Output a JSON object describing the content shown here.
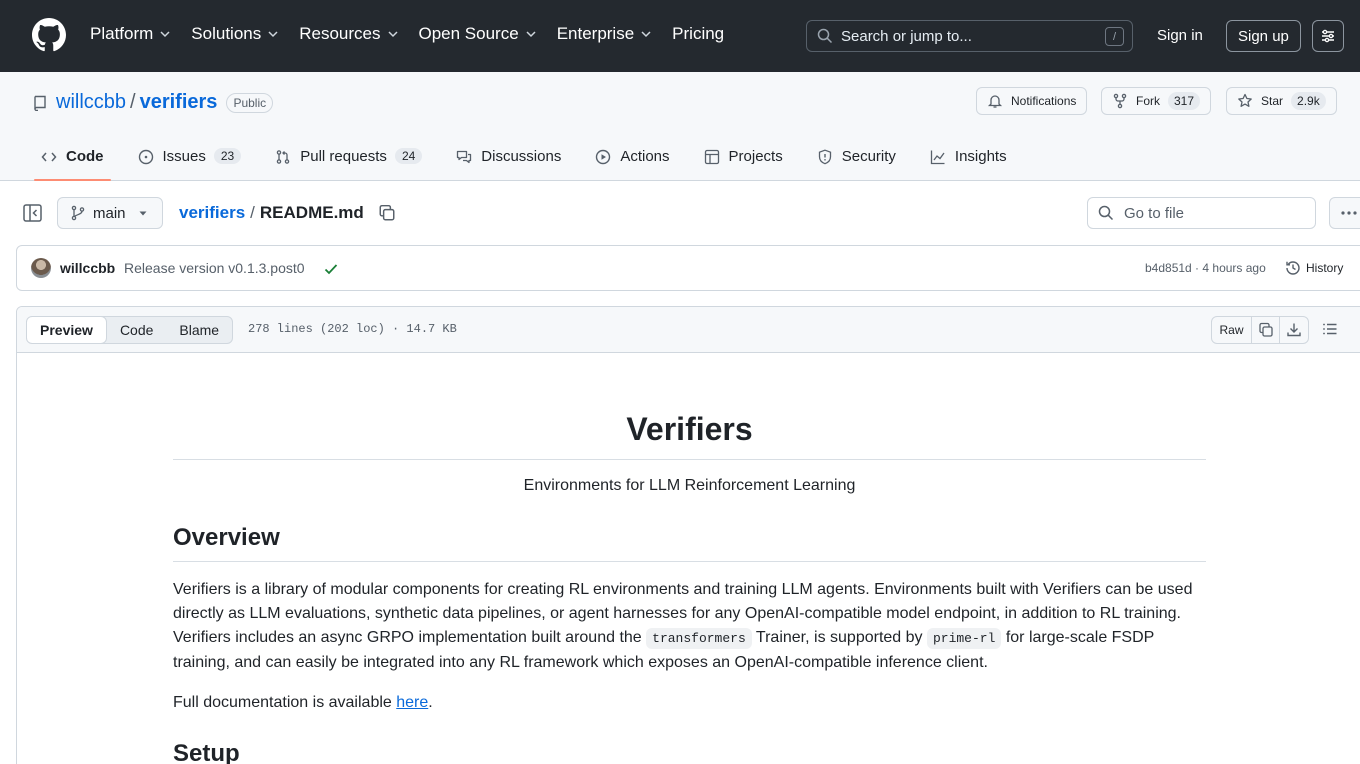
{
  "header": {
    "nav": [
      "Platform",
      "Solutions",
      "Resources",
      "Open Source",
      "Enterprise",
      "Pricing"
    ],
    "search_placeholder": "Search or jump to...",
    "search_shortcut": "/",
    "sign_in": "Sign in",
    "sign_up": "Sign up"
  },
  "repo": {
    "owner": "willccbb",
    "separator": "/",
    "name": "verifiers",
    "visibility": "Public",
    "notifications_label": "Notifications",
    "fork_label": "Fork",
    "fork_count": "317",
    "star_label": "Star",
    "star_count": "2.9k"
  },
  "tabs": [
    {
      "label": "Code",
      "icon": "code-icon",
      "active": true
    },
    {
      "label": "Issues",
      "icon": "issue-icon",
      "count": "23"
    },
    {
      "label": "Pull requests",
      "icon": "pull-request-icon",
      "count": "24"
    },
    {
      "label": "Discussions",
      "icon": "discussion-icon"
    },
    {
      "label": "Actions",
      "icon": "play-icon"
    },
    {
      "label": "Projects",
      "icon": "table-icon"
    },
    {
      "label": "Security",
      "icon": "shield-icon"
    },
    {
      "label": "Insights",
      "icon": "graph-icon"
    }
  ],
  "file_nav": {
    "branch": "main",
    "breadcrumb_repo": "verifiers",
    "breadcrumb_sep": "/",
    "breadcrumb_file": "README.md",
    "goto_placeholder": "Go to file"
  },
  "commit": {
    "author": "willccbb",
    "message": "Release version v0.1.3.post0",
    "sha": "b4d851d",
    "time": "4 hours ago",
    "meta_sep": " · ",
    "history_label": "History"
  },
  "file_header": {
    "views": [
      "Preview",
      "Code",
      "Blame"
    ],
    "info": "278 lines (202 loc) · 14.7 KB",
    "raw_label": "Raw"
  },
  "readme": {
    "title": "Verifiers",
    "subtitle": "Environments for LLM Reinforcement Learning",
    "overview_heading": "Overview",
    "para1_a": "Verifiers is a library of modular components for creating RL environments and training LLM agents. Environments built with Verifiers can be used directly as LLM evaluations, synthetic data pipelines, or agent harnesses for any OpenAI-compatible model endpoint, in addition to RL training. Verifiers includes an async GRPO implementation built around the ",
    "code1": "transformers",
    "para1_b": " Trainer, is supported by ",
    "code2": "prime-rl",
    "para1_c": " for large-scale FSDP training, and can easily be integrated into any RL framework which exposes an OpenAI-compatible inference client.",
    "para2_a": "Full documentation is available ",
    "para2_link": "here",
    "para2_b": ".",
    "setup_heading": "Setup"
  },
  "colors": {
    "header_bg": "#24292f",
    "link": "#0969da",
    "active_tab_underline": "#fd8c73",
    "success": "#1a7f37"
  }
}
